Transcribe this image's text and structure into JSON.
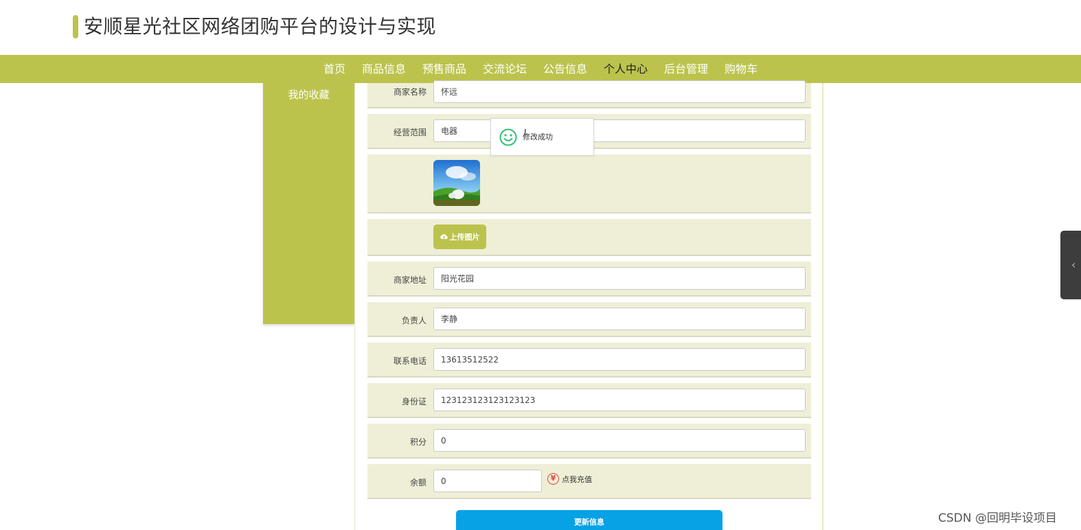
{
  "header": {
    "title": "安顺星光社区网络团购平台的设计与实现"
  },
  "nav": {
    "items": [
      {
        "label": "首页"
      },
      {
        "label": "商品信息"
      },
      {
        "label": "预售商品"
      },
      {
        "label": "交流论坛"
      },
      {
        "label": "公告信息"
      },
      {
        "label": "个人中心"
      },
      {
        "label": "后台管理"
      },
      {
        "label": "购物车"
      }
    ],
    "active": "个人中心"
  },
  "sidebar": {
    "items": [
      {
        "label": "我的收藏"
      }
    ]
  },
  "form": {
    "merchant_name": {
      "label": "商家名称",
      "value": "怀远"
    },
    "business_scope": {
      "label": "经营范围",
      "value": "电器"
    },
    "upload_label": "上传图片",
    "address": {
      "label": "商家地址",
      "value": "阳光花园"
    },
    "contact_person": {
      "label": "负责人",
      "value": "李静"
    },
    "phone": {
      "label": "联系电话",
      "value": "13613512522"
    },
    "id_card": {
      "label": "身份证",
      "value": "123123123123123123"
    },
    "points": {
      "label": "积分",
      "value": "0"
    },
    "balance": {
      "label": "余额",
      "value": "0"
    },
    "recharge_label": "点我充值",
    "recharge_symbol": "¥",
    "update_label": "更新信息"
  },
  "toast": {
    "message": "修改成功",
    "icon": "smile-icon",
    "color": "#2fbf71"
  },
  "watermark": "CSDN @回明毕设项目",
  "colors": {
    "accent": "#bcc34d",
    "row_bg": "#efefd7",
    "primary_button": "#06a2e5"
  }
}
